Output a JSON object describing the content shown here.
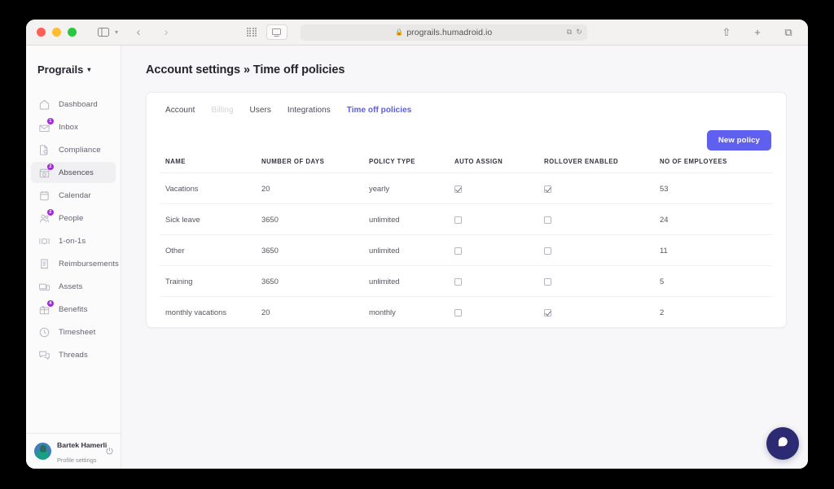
{
  "browser": {
    "url": "prograils.humadroid.io",
    "lock_icon": "lock-icon",
    "traffic_lights": [
      "close",
      "minimize",
      "zoom"
    ],
    "icons": {
      "sidebar_toggle": "sidebar-toggle-icon",
      "chevron_down": "chevron-down-icon",
      "back": "back-arrow-icon",
      "forward": "forward-arrow-icon",
      "grid": "grid-icon",
      "reader": "reader-view-icon",
      "extensions": "extensions-icon",
      "reload": "reload-icon",
      "share": "share-icon",
      "new_tab": "plus-icon",
      "tab_overview": "tab-overview-icon"
    },
    "back_glyph": "‹",
    "forward_glyph": "›",
    "lock_glyph": "🔒",
    "reload_glyph": "↻",
    "extensions_glyph": "⧉",
    "share_glyph": "⇧",
    "plus_glyph": "+",
    "tabs_glyph": "⧉",
    "caret_glyph": "▾"
  },
  "sidebar": {
    "brand": "Prograils",
    "brand_caret": "▾",
    "items": [
      {
        "label": "Dashboard",
        "icon": "home-icon",
        "badge": "",
        "active": false
      },
      {
        "label": "Inbox",
        "icon": "inbox-icon",
        "badge": "1",
        "active": false
      },
      {
        "label": "Compliance",
        "icon": "compliance-icon",
        "badge": "",
        "active": false
      },
      {
        "label": "Absences",
        "icon": "absences-icon",
        "badge": "2",
        "active": true
      },
      {
        "label": "Calendar",
        "icon": "calendar-icon",
        "badge": "",
        "active": false
      },
      {
        "label": "People",
        "icon": "people-icon",
        "badge": "2",
        "active": false
      },
      {
        "label": "1-on-1s",
        "icon": "one-on-one-icon",
        "badge": "",
        "active": false
      },
      {
        "label": "Reimbursements",
        "icon": "receipt-icon",
        "badge": "",
        "active": false
      },
      {
        "label": "Assets",
        "icon": "assets-icon",
        "badge": "",
        "active": false
      },
      {
        "label": "Benefits",
        "icon": "benefits-icon",
        "badge": "4",
        "active": false
      },
      {
        "label": "Timesheet",
        "icon": "clock-icon",
        "badge": "",
        "active": false
      },
      {
        "label": "Threads",
        "icon": "threads-icon",
        "badge": "",
        "active": false
      }
    ],
    "profile": {
      "name": "Bartek Hamerli",
      "subtitle": "Profile settings",
      "avatar": "user-avatar",
      "logout_icon": "power-icon"
    }
  },
  "main": {
    "page_title": "Account settings » Time off policies",
    "tabs": [
      {
        "label": "Account",
        "state": "normal"
      },
      {
        "label": "Billing",
        "state": "disabled"
      },
      {
        "label": "Users",
        "state": "normal"
      },
      {
        "label": "Integrations",
        "state": "normal"
      },
      {
        "label": "Time off policies",
        "state": "active"
      }
    ],
    "new_policy_label": "New policy",
    "table": {
      "headers": [
        "NAME",
        "NUMBER OF DAYS",
        "POLICY TYPE",
        "AUTO ASSIGN",
        "ROLLOVER ENABLED",
        "NO OF EMPLOYEES"
      ],
      "rows": [
        {
          "name": "Vacations",
          "days": "20",
          "type": "yearly",
          "auto_assign": true,
          "rollover": true,
          "employees": "53"
        },
        {
          "name": "Sick leave",
          "days": "3650",
          "type": "unlimited",
          "auto_assign": false,
          "rollover": false,
          "employees": "24"
        },
        {
          "name": "Other",
          "days": "3650",
          "type": "unlimited",
          "auto_assign": false,
          "rollover": false,
          "employees": "11"
        },
        {
          "name": "Training",
          "days": "3650",
          "type": "unlimited",
          "auto_assign": false,
          "rollover": false,
          "employees": "5"
        },
        {
          "name": "monthly vacations",
          "days": "20",
          "type": "monthly",
          "auto_assign": false,
          "rollover": true,
          "employees": "2"
        }
      ]
    },
    "chat_widget": {
      "icon": "chat-bubble-icon"
    }
  },
  "colors": {
    "accent": "#5f5ff0",
    "active_tab": "#5a5ae8",
    "badge": "#a32ad8",
    "chat_fab": "#2b2a73",
    "page_bg": "#f7f7fa"
  }
}
